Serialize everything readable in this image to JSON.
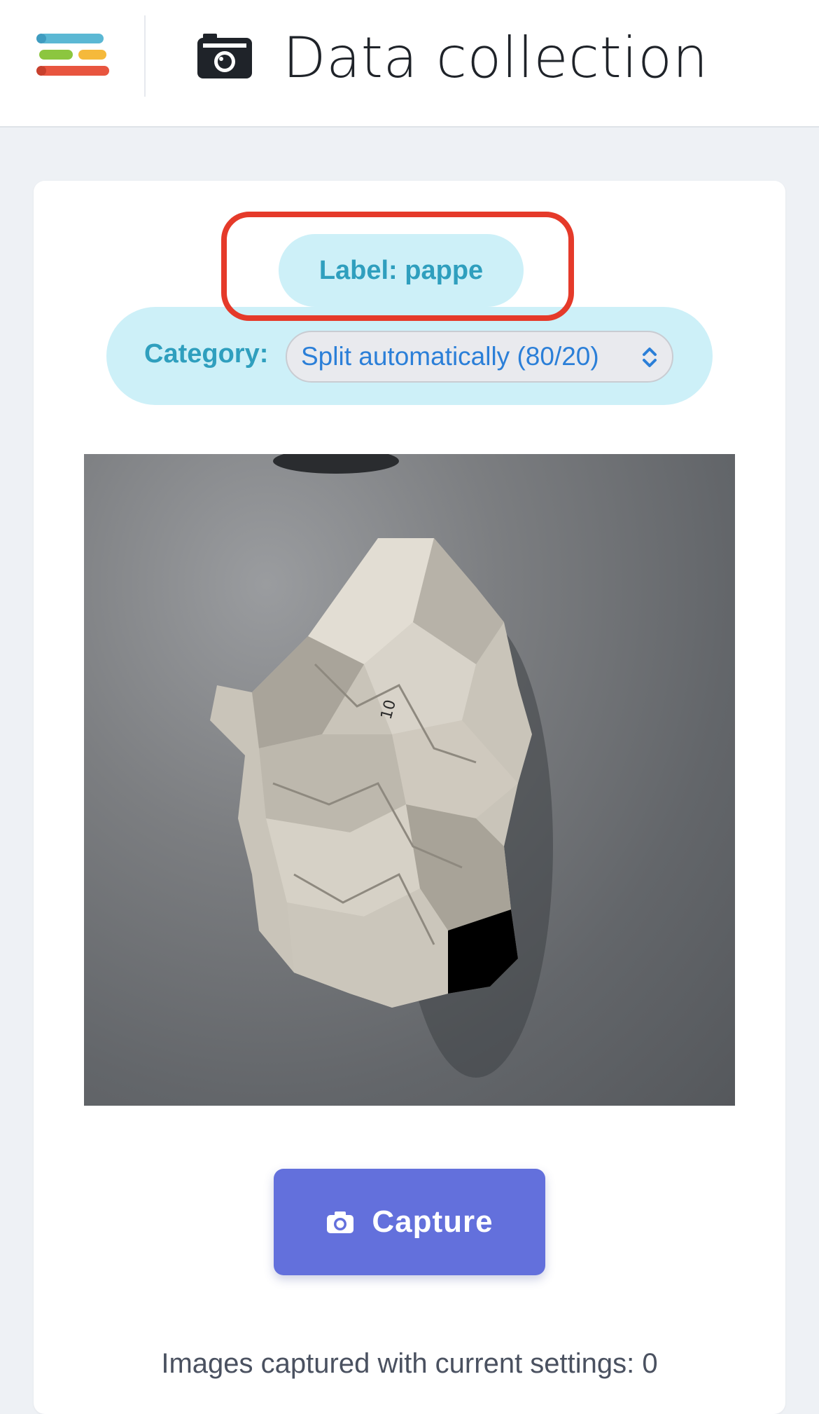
{
  "header": {
    "title": "Data collection",
    "menu_icon": "hamburger-menu-icon",
    "title_icon": "camera-icon"
  },
  "label": {
    "text": "Label: pappe"
  },
  "category": {
    "label": "Category:",
    "selected": "Split automatically (80/20)"
  },
  "preview": {
    "subject": "crumpled paper on gray surface"
  },
  "capture": {
    "label": "Capture",
    "icon": "camera-icon"
  },
  "status": {
    "text": "Images captured with current settings: 0"
  },
  "colors": {
    "accent": "#6370dc",
    "pill_bg": "#cdf0f8",
    "pill_text": "#2f9fbe",
    "highlight": "#e53a2a",
    "logo": [
      "#5bb8d4",
      "#8cc63f",
      "#f5b93b",
      "#e8553f"
    ]
  }
}
